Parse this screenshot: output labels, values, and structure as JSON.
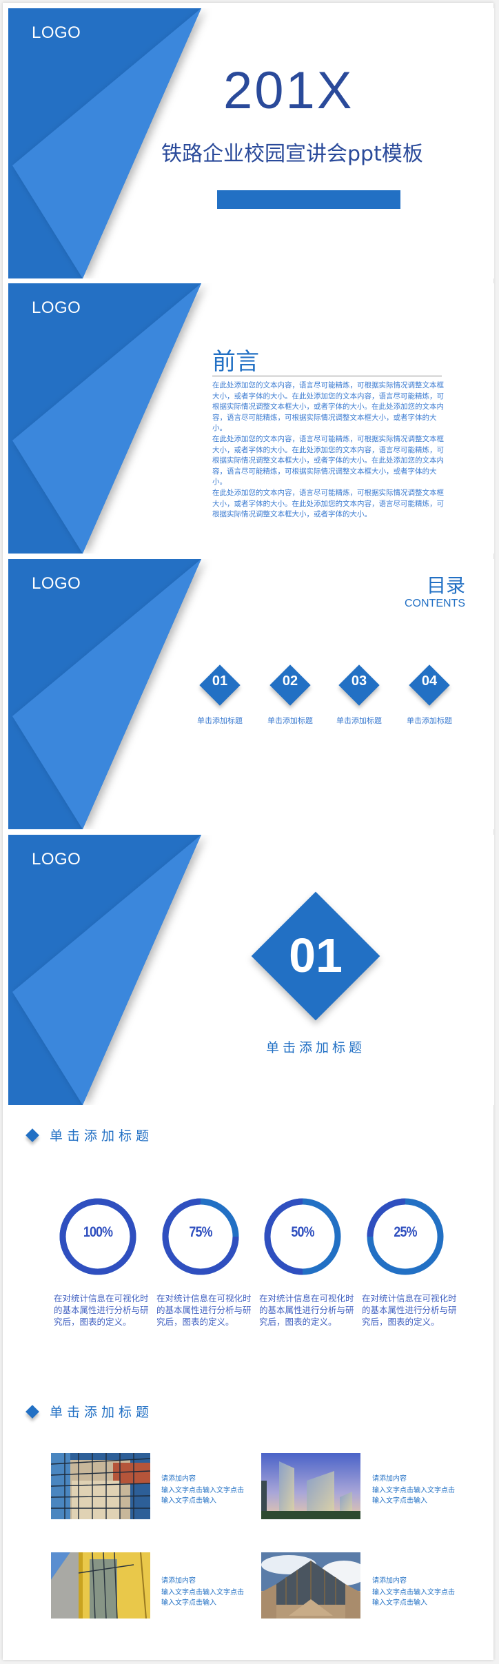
{
  "colors": {
    "primary": "#2270c4",
    "primary_light": "#3b87dc",
    "title_navy": "#2a4a9a",
    "donut_value": "#2f4fbf",
    "donut_rest": "#2270c4"
  },
  "slides": {
    "logo": "LOGO",
    "cover": {
      "year": "201X",
      "subtitle": "铁路企业校园宣讲会ppt模板"
    },
    "preface": {
      "title": "前言",
      "paragraphs": [
        "在此处添加您的文本内容，语言尽可能精炼，可根据实际情况调整文本框大小，或者字体的大小。在此处添加您的文本内容，语言尽可能精炼，可根据实际情况调整文本框大小，或者字体的大小。在此处添加您的文本内容，语言尽可能精炼，可根据实际情况调整文本框大小，或者字体的大小。",
        "在此处添加您的文本内容，语言尽可能精炼，可根据实际情况调整文本框大小，或者字体的大小。在此处添加您的文本内容，语言尽可能精炼，可根据实际情况调整文本框大小，或者字体的大小。在此处添加您的文本内容，语言尽可能精炼，可根据实际情况调整文本框大小，或者字体的大小。",
        "在此处添加您的文本内容，语言尽可能精炼，可根据实际情况调整文本框大小，或者字体的大小。在此处添加您的文本内容，语言尽可能精炼，可根据实际情况调整文本框大小，或者字体的大小。"
      ]
    },
    "contents": {
      "title": "目录",
      "subtitle": "CONTENTS",
      "items": [
        {
          "num": "01",
          "label": "单击添加标题"
        },
        {
          "num": "02",
          "label": "单击添加标题"
        },
        {
          "num": "03",
          "label": "单击添加标题"
        },
        {
          "num": "04",
          "label": "单击添加标题"
        }
      ]
    },
    "section": {
      "num": "01",
      "label": "单击添加标题"
    }
  },
  "stats_section": {
    "heading": "单击添加标题",
    "items": [
      {
        "value_label": "100%",
        "percent": 100,
        "desc": "在对统计信息在可视化时的基本属性进行分析与研究后，图表的定义。"
      },
      {
        "value_label": "75%",
        "percent": 75,
        "desc": "在对统计信息在可视化时的基本属性进行分析与研究后，图表的定义。"
      },
      {
        "value_label": "50%",
        "percent": 50,
        "desc": "在对统计信息在可视化时的基本属性进行分析与研究后，图表的定义。"
      },
      {
        "value_label": "25%",
        "percent": 25,
        "desc": "在对统计信息在可视化时的基本属性进行分析与研究后，图表的定义。"
      }
    ]
  },
  "gallery_section": {
    "heading": "单击添加标题",
    "cards": [
      {
        "photo": "glass-facade-reflection",
        "title": "请添加内容",
        "body": "输入文字点击输入文字点击输入文字点击输入"
      },
      {
        "photo": "office-towers-dusk",
        "title": "请添加内容",
        "body": "输入文字点击输入文字点击输入文字点击输入"
      },
      {
        "photo": "yellow-steel-facade",
        "title": "请添加内容",
        "body": "输入文字点击输入文字点击输入文字点击输入"
      },
      {
        "photo": "glass-pyramid-building",
        "title": "请添加内容",
        "body": "输入文字点击输入文字点击输入文字点击输入"
      }
    ]
  }
}
